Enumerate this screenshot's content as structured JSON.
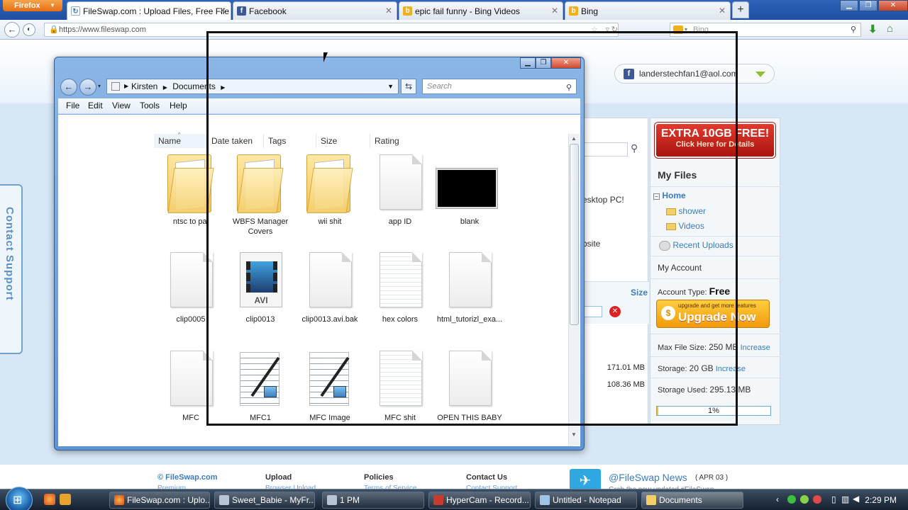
{
  "browser": {
    "firefox_label": "Firefox",
    "tabs": [
      {
        "title": "FileSwap.com : Upload Files, Free File ...",
        "icon": "fileswap-icon"
      },
      {
        "title": "Facebook",
        "icon": "facebook-icon"
      },
      {
        "title": "epic fail funny - Bing Videos",
        "icon": "bing-icon"
      },
      {
        "title": "Bing",
        "icon": "bing-icon"
      }
    ],
    "url": "https://www.fileswap.com",
    "search_placeholder": "Bing",
    "colors": {
      "firefox": "#e66e13",
      "bing": "#f2b01e",
      "facebook": "#3b5998"
    }
  },
  "site": {
    "facebook_account": "landerstechfan1@aol.com",
    "contact_support": "Contact Support",
    "peek": {
      "desktop": "esktop PC!",
      "website": "bsite",
      "size_header": "Size",
      "size1": "171.01 MB",
      "size2": "108.36 MB"
    },
    "promo": {
      "line1": "EXTRA 10GB FREE!",
      "line2": "Click Here for Details"
    },
    "my_files": "My Files",
    "tree": {
      "home": "Home",
      "items": [
        "shower",
        "Videos"
      ]
    },
    "recent_uploads": "Recent Uploads",
    "my_account": "My Account",
    "account_type_label": "Account Type:",
    "account_type": "Free",
    "upgrade_small": "upgrade and get more features",
    "upgrade_label": "Upgrade Now",
    "max_file_size_label": "Max File Size:",
    "max_file_size": "250 MB",
    "storage_label": "Storage:",
    "storage": "20 GB",
    "increase": "Increase",
    "storage_used_label": "Storage Used:",
    "storage_used": "295.13 MB",
    "storage_pct_text": "1%",
    "storage_pct": 0.01,
    "footer": {
      "brand": "© FileSwap.com",
      "brand_sub": "Premium",
      "upload": "Upload",
      "upload_sub": "Browser Upload",
      "policies": "Policies",
      "policies_sub": "Terms of Service",
      "contact": "Contact Us",
      "contact_sub": "Contact Support",
      "news": "@FileSwap News",
      "news_date": "( APR 03 )",
      "news_sub": "Grab the new updated #FileSwap ..."
    }
  },
  "explorer": {
    "breadcrumb": [
      "Kirsten",
      "Documents"
    ],
    "search_placeholder": "Search",
    "menu": [
      "File",
      "Edit",
      "View",
      "Tools",
      "Help"
    ],
    "columns": [
      "Name",
      "Date taken",
      "Tags",
      "Size",
      "Rating"
    ],
    "items": [
      {
        "name": "ntsc to pal",
        "type": "folder"
      },
      {
        "name": "WBFS Manager Covers",
        "type": "folder"
      },
      {
        "name": "wii shit",
        "type": "folder"
      },
      {
        "name": "app ID",
        "type": "file"
      },
      {
        "name": "blank",
        "type": "image"
      },
      {
        "name": "clip0005",
        "type": "file"
      },
      {
        "name": "clip0013",
        "type": "avi"
      },
      {
        "name": "clip0013.avi.bak",
        "type": "file"
      },
      {
        "name": "hex colors",
        "type": "lined"
      },
      {
        "name": "html_tutorizl_exa...",
        "type": "file"
      },
      {
        "name": "MFC",
        "type": "file"
      },
      {
        "name": "MFC1",
        "type": "doc"
      },
      {
        "name": "MFC Image",
        "type": "doc"
      },
      {
        "name": "MFC shit",
        "type": "lined"
      },
      {
        "name": "OPEN THIS BABY",
        "type": "file"
      }
    ]
  },
  "taskbar": {
    "items": [
      {
        "label": "FileSwap.com : Uplo...",
        "icon": "firefox-icon"
      },
      {
        "label": "Sweet_Babie - MyFr...",
        "icon": "messenger-icon"
      },
      {
        "label": "1 PM",
        "icon": "chat-icon"
      },
      {
        "label": "HyperCam - Record...",
        "icon": "hypercam-icon"
      },
      {
        "label": "Untitled - Notepad",
        "icon": "notepad-icon"
      },
      {
        "label": "Documents",
        "icon": "explorer-icon"
      }
    ],
    "clock": "2:29 PM"
  }
}
